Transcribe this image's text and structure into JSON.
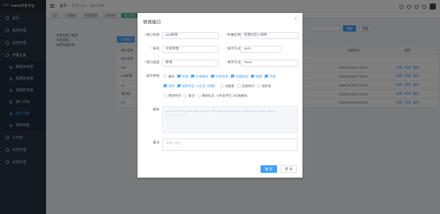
{
  "sidebar": {
    "logo_mark": "</>",
    "logo_text": "erdmu开发平台",
    "items": [
      {
        "label": "首页"
      },
      {
        "label": "系统管理"
      },
      {
        "label": "监控管理"
      },
      {
        "label": "开发工具"
      }
    ],
    "sub_items": [
      {
        "label": "数据库管理"
      },
      {
        "label": "数据库管理"
      },
      {
        "label": "数据表管理"
      },
      {
        "label": "接口文档"
      },
      {
        "label": "接口列表"
      },
      {
        "label": "菜单构建"
      }
    ],
    "bottom_items": [
      {
        "label": "工作流"
      },
      {
        "label": "内容管理"
      },
      {
        "label": "内容管理"
      }
    ]
  },
  "header": {
    "breadcrumb": [
      "首页",
      "/",
      "开发工具",
      "/",
      "接口列表"
    ]
  },
  "tags": [
    "首页",
    "应用管理",
    "表设置管理",
    "组织结构",
    "接口列表"
  ],
  "background": {
    "tree": [
      "智慧社区小程序",
      "审批管理",
      "通用管理系统"
    ],
    "add_button": "+ 添加接口",
    "search_button": "搜索",
    "reset_button": "重置",
    "table": {
      "headers": [
        "接口名称",
        "",
        "创建时间",
        "操作"
      ],
      "rows": [
        {
          "name": "接口名称",
          "time": "",
          "ops": []
        },
        {
          "name": "test",
          "time": "2020-05-26 17:25:57",
          "ops": [
            "修改",
            "新增",
            "删除"
          ]
        },
        {
          "name": "test新增",
          "time": "2020-05-26 17:25:57",
          "ops": [
            "修改",
            "新增",
            "删除"
          ]
        },
        {
          "name": "12",
          "time": "2020-05-26 17:04:04",
          "ops": [
            "修改",
            "新增",
            "删除"
          ]
        },
        {
          "name": "我的接",
          "time": "2020-05-26 17:04:04",
          "ops": [
            "修改",
            "新增",
            "删除"
          ]
        },
        {
          "name": "ert",
          "time": "2020-05-26 09:42:15",
          "ops": [
            "修改",
            "新增",
            "删除"
          ]
        }
      ]
    }
  },
  "dialog": {
    "title": "修改接口",
    "close": "×",
    "fields": {
      "name_label": "接口名称",
      "name_value": "test新增",
      "app_label": "所属应用",
      "app_value": "智慧社区小程序",
      "table_label": "表名",
      "table_value": "文章管理",
      "method_label": "请求方式",
      "method_value": "post",
      "type_label": "接口类型",
      "type_value": "新增",
      "path_label": "请求方法",
      "path_value": "/save",
      "ops_label": "操作参数",
      "sql_label": "脚本",
      "sql_value": "insert into cms_article (title,category_id,image,name,summary,contents,sort,status) values (?,?,?,?,?,?,?,?)",
      "note_label": "备注",
      "note_placeholder": "请输入备注"
    },
    "checkboxes": [
      {
        "label": "编号",
        "checked": false
      },
      {
        "label": "标题",
        "checked": true
      },
      {
        "label": "栏目编号",
        "checked": true
      },
      {
        "label": "栏目名称",
        "checked": true
      },
      {
        "label": "封面地址",
        "checked": true
      },
      {
        "label": "摘要",
        "checked": true
      },
      {
        "label": "内容",
        "checked": true
      },
      {
        "label": "排序",
        "checked": true
      },
      {
        "label": "发布状态（0正常 1草稿）",
        "checked": true
      },
      {
        "label": "创建者",
        "checked": false
      },
      {
        "label": "创建时间",
        "checked": false
      },
      {
        "label": "更新者",
        "checked": false
      },
      {
        "label": "更新时间",
        "checked": false
      },
      {
        "label": "备注",
        "checked": false
      },
      {
        "label": "删除标志（0代表存在 2代表删除）",
        "checked": false
      }
    ],
    "ok": "确 定",
    "cancel": "取 消"
  }
}
